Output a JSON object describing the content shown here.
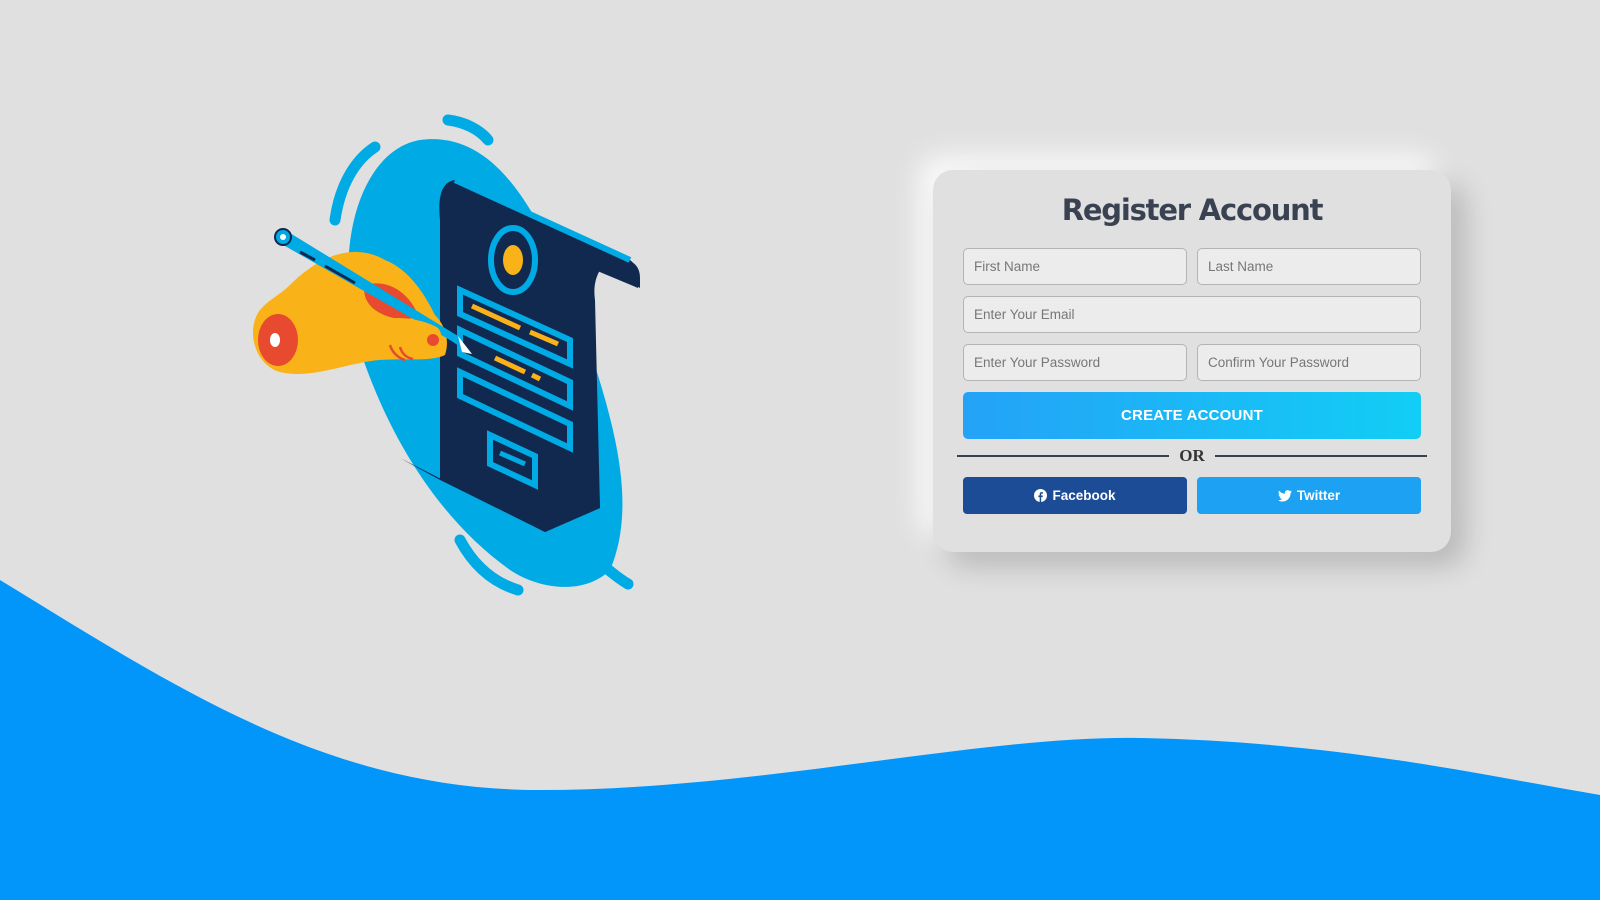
{
  "form": {
    "title": "Register Account",
    "first_name_placeholder": "First Name",
    "last_name_placeholder": "Last Name",
    "email_placeholder": "Enter Your Email",
    "password_placeholder": "Enter Your Password",
    "confirm_password_placeholder": "Confirm Your Password",
    "create_button_label": "CREATE ACCOUNT",
    "divider_text": "OR"
  },
  "social": {
    "facebook_label": "Facebook",
    "facebook_icon": "facebook-icon",
    "twitter_label": "Twitter",
    "twitter_icon": "twitter-icon"
  },
  "colors": {
    "background": "#e0e0e0",
    "wave": "#0296fb",
    "title": "#3a4252",
    "create_gradient_start": "#24a2f7",
    "create_gradient_end": "#12cef5",
    "facebook": "#1d4c96",
    "twitter": "#1da1f2",
    "illustration_blue": "#00aae4",
    "illustration_navy": "#12294f",
    "illustration_yellow": "#f9b218",
    "illustration_red": "#e84a2f"
  }
}
